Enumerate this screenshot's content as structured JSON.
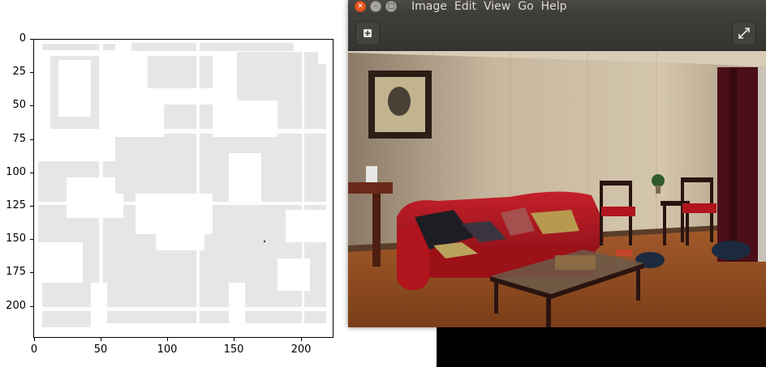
{
  "plot": {
    "y_ticks": [
      "0",
      "25",
      "50",
      "75",
      "100",
      "125",
      "150",
      "175",
      "200"
    ],
    "x_ticks": [
      "0",
      "50",
      "100",
      "150",
      "200"
    ]
  },
  "viewer": {
    "window_buttons": [
      "close",
      "minimize",
      "maximize"
    ],
    "menu": [
      "Image",
      "Edit",
      "View",
      "Go",
      "Help"
    ],
    "toolbar": {
      "left_icon": "plus-icon",
      "right_icon": "fullscreen-icon"
    },
    "image_description": "living room photo"
  },
  "colors": {
    "titlebar": "#3c3b37",
    "accent": "#e95420",
    "plot_gray": "#e6e6e6"
  }
}
